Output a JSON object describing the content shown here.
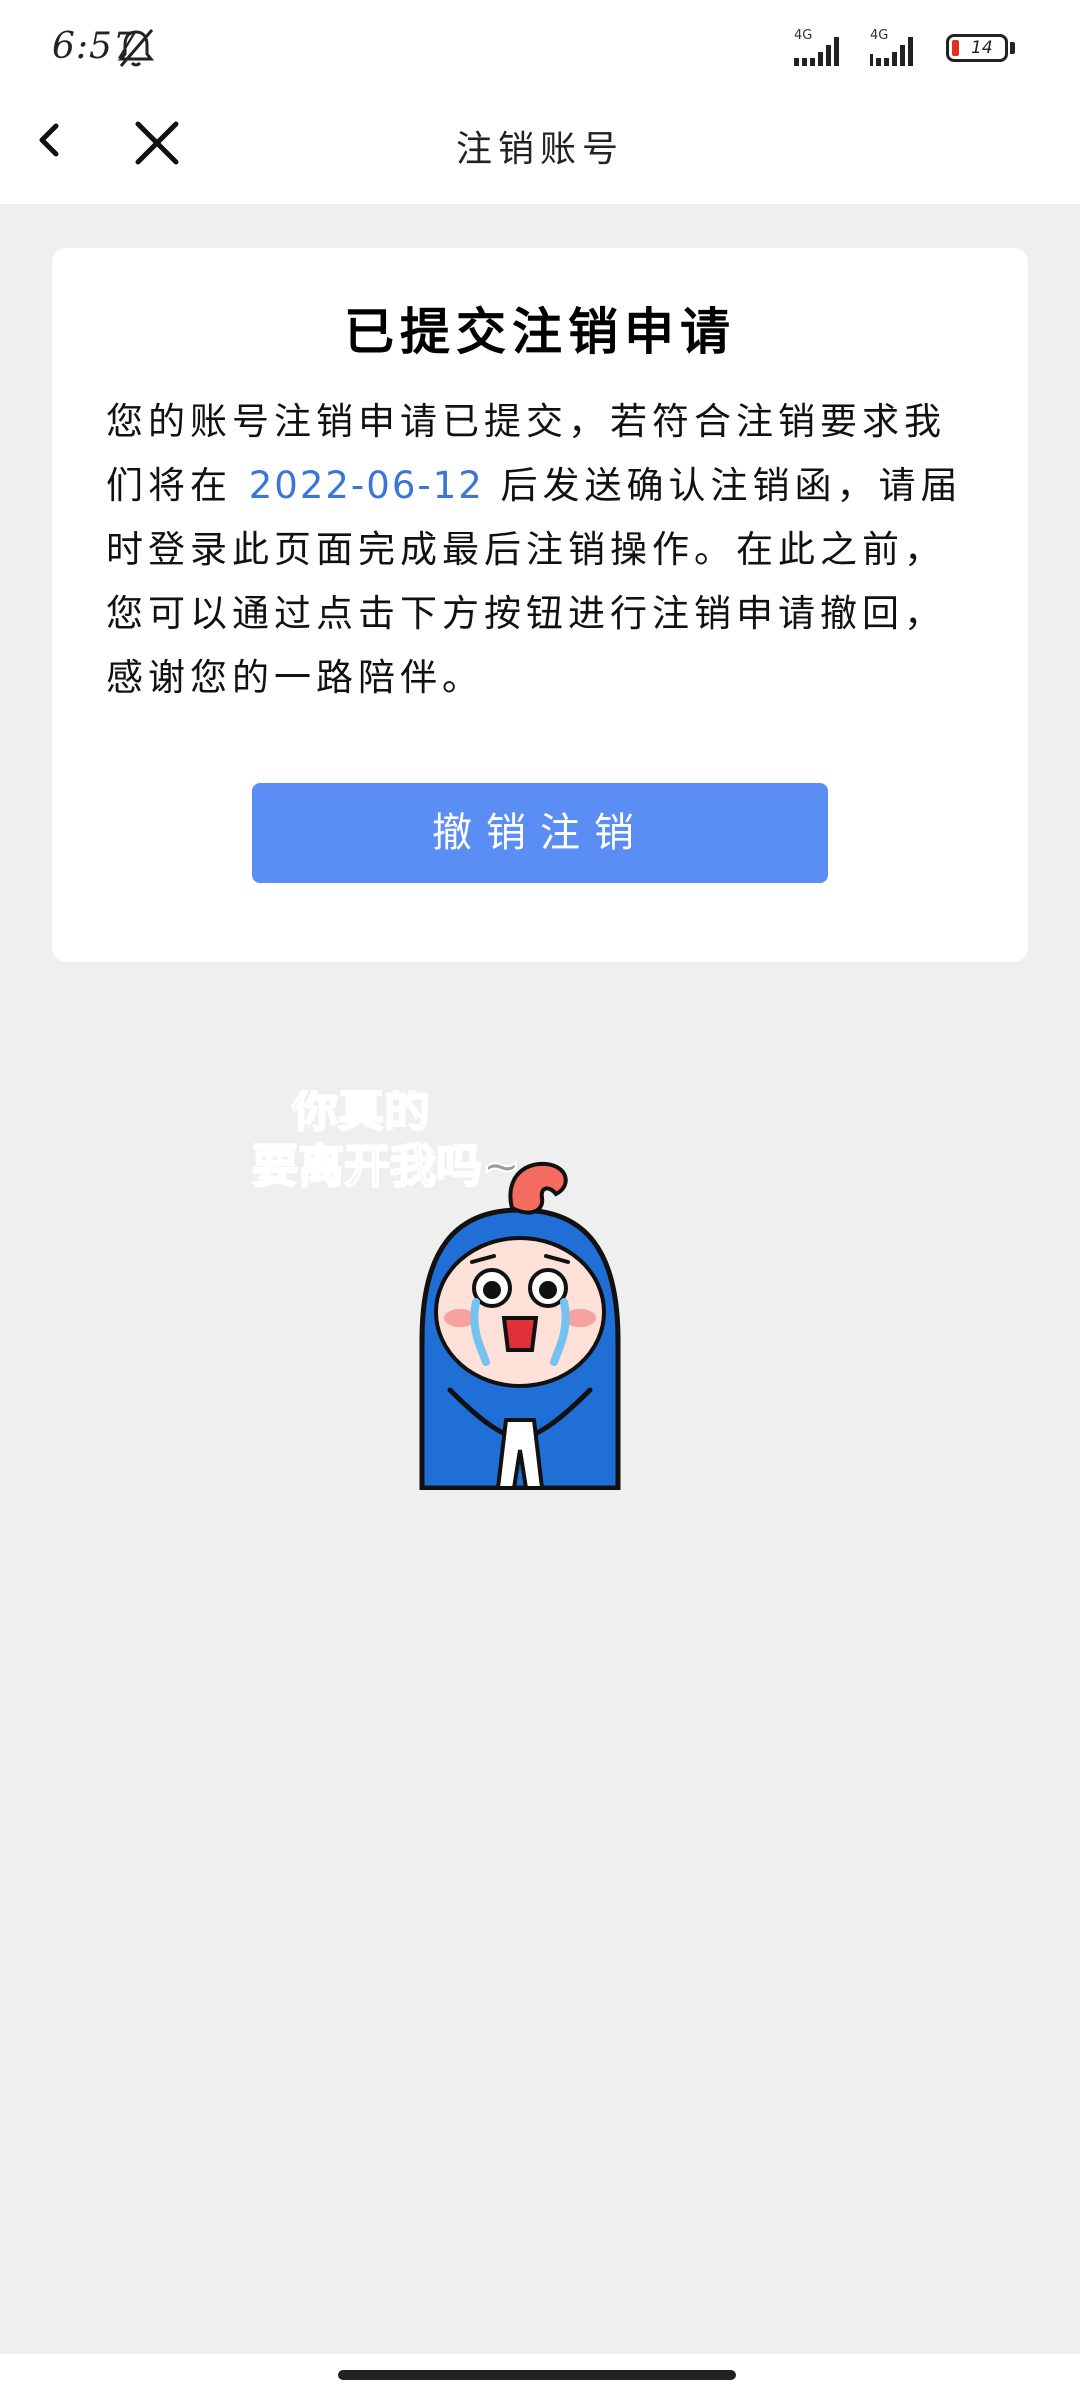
{
  "status": {
    "time": "6:57",
    "network1": "4G",
    "network2": "4G",
    "battery_level": "14"
  },
  "nav": {
    "title": "注销账号"
  },
  "card": {
    "title": "已提交注销申请",
    "body_before": "您的账号注销申请已提交，若符合注销要求我们将在 ",
    "date": "2022-06-12",
    "body_after": " 后发送确认注销函，请届时登录此页面完成最后注销操作。在此之前，您可以通过点击下方按钮进行注销申请撤回，感谢您的一路陪伴。",
    "button_label": "撤销注销"
  },
  "sticker": {
    "line1": "你真的",
    "line2": "要离开我吗~"
  },
  "colors": {
    "accent": "#5b8ef5",
    "date_link": "#3a76d8",
    "page_bg": "#efefef"
  }
}
